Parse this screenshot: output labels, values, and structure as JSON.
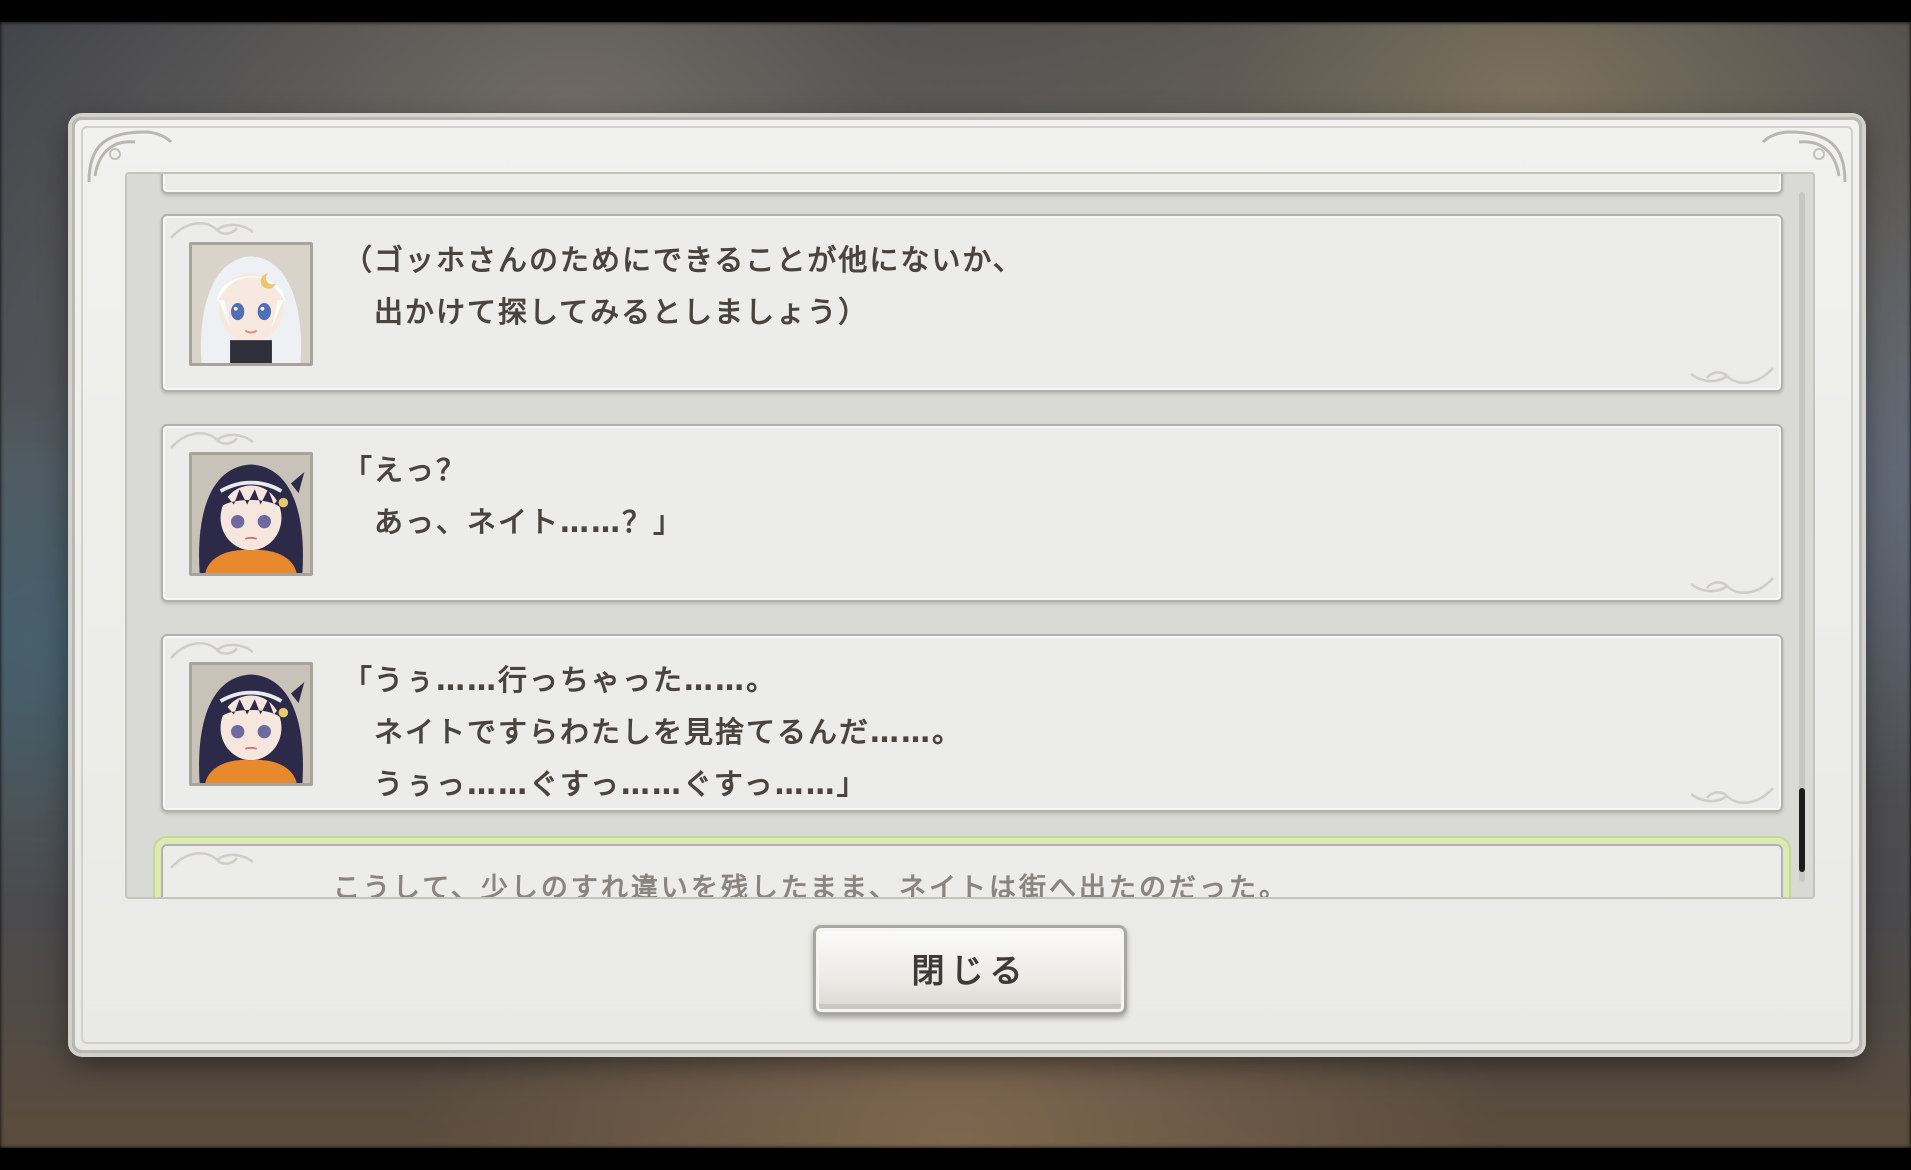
{
  "dialogue_log": {
    "entries": [
      {
        "speaker_icon": "white-haired-girl-portrait",
        "lines": [
          "（ゴッホさんのためにできることが他にないか、",
          "　出かけて探してみるとしましょう）"
        ]
      },
      {
        "speaker_icon": "dark-haired-girl-portrait",
        "lines": [
          "「えっ？",
          "　あっ、ネイト……？」"
        ]
      },
      {
        "speaker_icon": "dark-haired-girl-portrait",
        "lines": [
          "「うぅ……行っちゃった……。",
          "　ネイトですらわたしを見捨てるんだ……。",
          "　うぅっ……ぐすっ……ぐすっ……」"
        ]
      }
    ],
    "narration": "こうして、少しのすれ違いを残したまま、ネイトは街へ出たのだった。"
  },
  "close_button_label": "閉じる"
}
